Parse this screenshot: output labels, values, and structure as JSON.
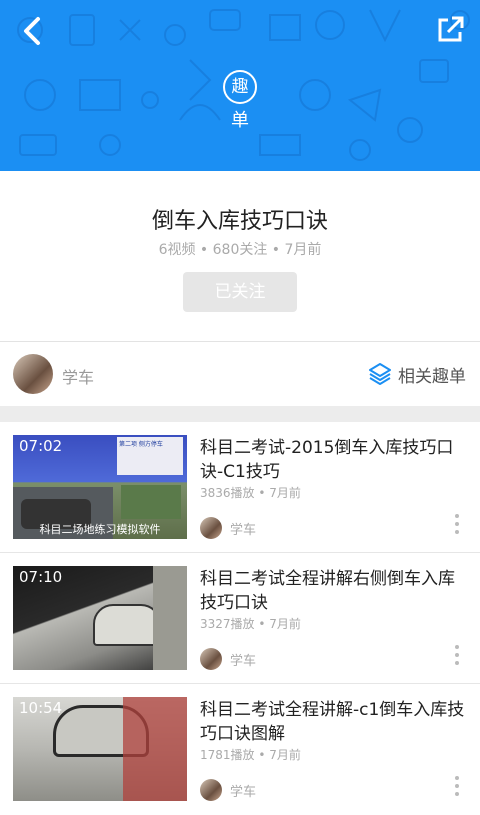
{
  "colors": {
    "header_blue": "#1b8ff3",
    "accent": "#1b8ff3"
  },
  "header": {
    "logo_char": "趣",
    "logo_text": "单",
    "back_icon": "back-arrow-icon",
    "share_icon": "share-icon"
  },
  "collection": {
    "title": "倒车入库技巧口诀",
    "meta": "6视频 • 680关注 • 7月前",
    "follow_label": "已关注"
  },
  "author": {
    "name": "学车",
    "related_label": "相关趣单",
    "related_icon": "layers-icon"
  },
  "videos": [
    {
      "duration": "07:02",
      "title": "科目二考试-2015倒车入库技巧口诀-C1技巧",
      "meta": "3836播放 • 7月前",
      "author": "学车",
      "thumb_caption": "科目二场地练习模拟软件",
      "thumb_small": "第二项 侧方停车"
    },
    {
      "duration": "07:10",
      "title": "科目二考试全程讲解右侧倒车入库技巧口诀",
      "meta": "3327播放 • 7月前",
      "author": "学车"
    },
    {
      "duration": "10:54",
      "title": "科目二考试全程讲解-c1倒车入库技巧口诀图解",
      "meta": "1781播放 • 7月前",
      "author": "学车"
    }
  ]
}
